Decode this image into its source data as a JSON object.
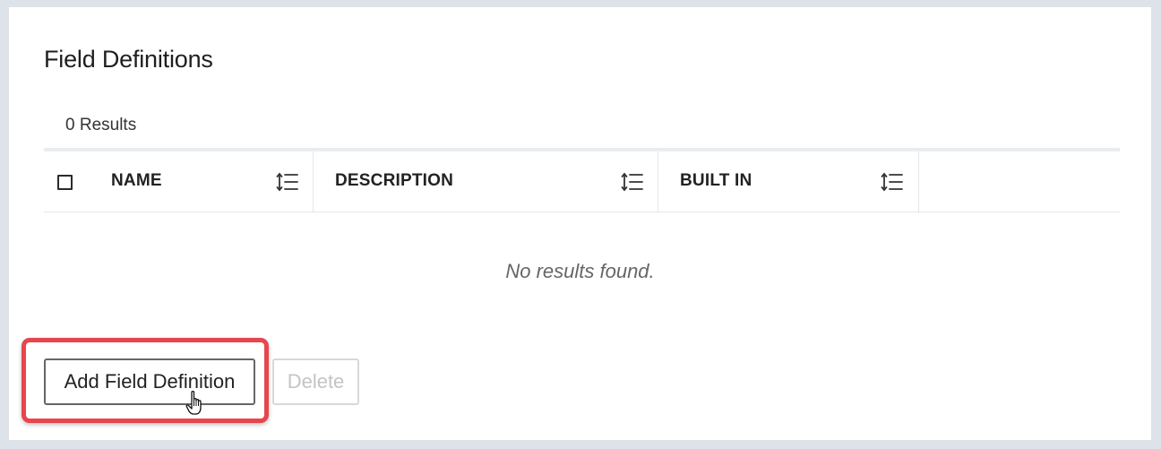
{
  "page": {
    "title": "Field Definitions",
    "results_count": "0 Results",
    "empty_message": "No results found."
  },
  "table": {
    "columns": [
      {
        "label": "NAME",
        "sort_icon": "sort-icon"
      },
      {
        "label": "DESCRIPTION",
        "sort_icon": "sort-icon"
      },
      {
        "label": "BUILT IN",
        "sort_icon": "sort-icon"
      }
    ],
    "rows": []
  },
  "actions": {
    "add_label": "Add Field Definition",
    "delete_label": "Delete",
    "delete_enabled": false
  },
  "colors": {
    "highlight": "#e8454d",
    "background": "#dde3e8",
    "panel": "#ffffff"
  },
  "icons": {
    "checkbox": "checkbox-unchecked-icon",
    "sort": "sort-icon",
    "cursor": "hand-pointer-cursor-icon"
  }
}
